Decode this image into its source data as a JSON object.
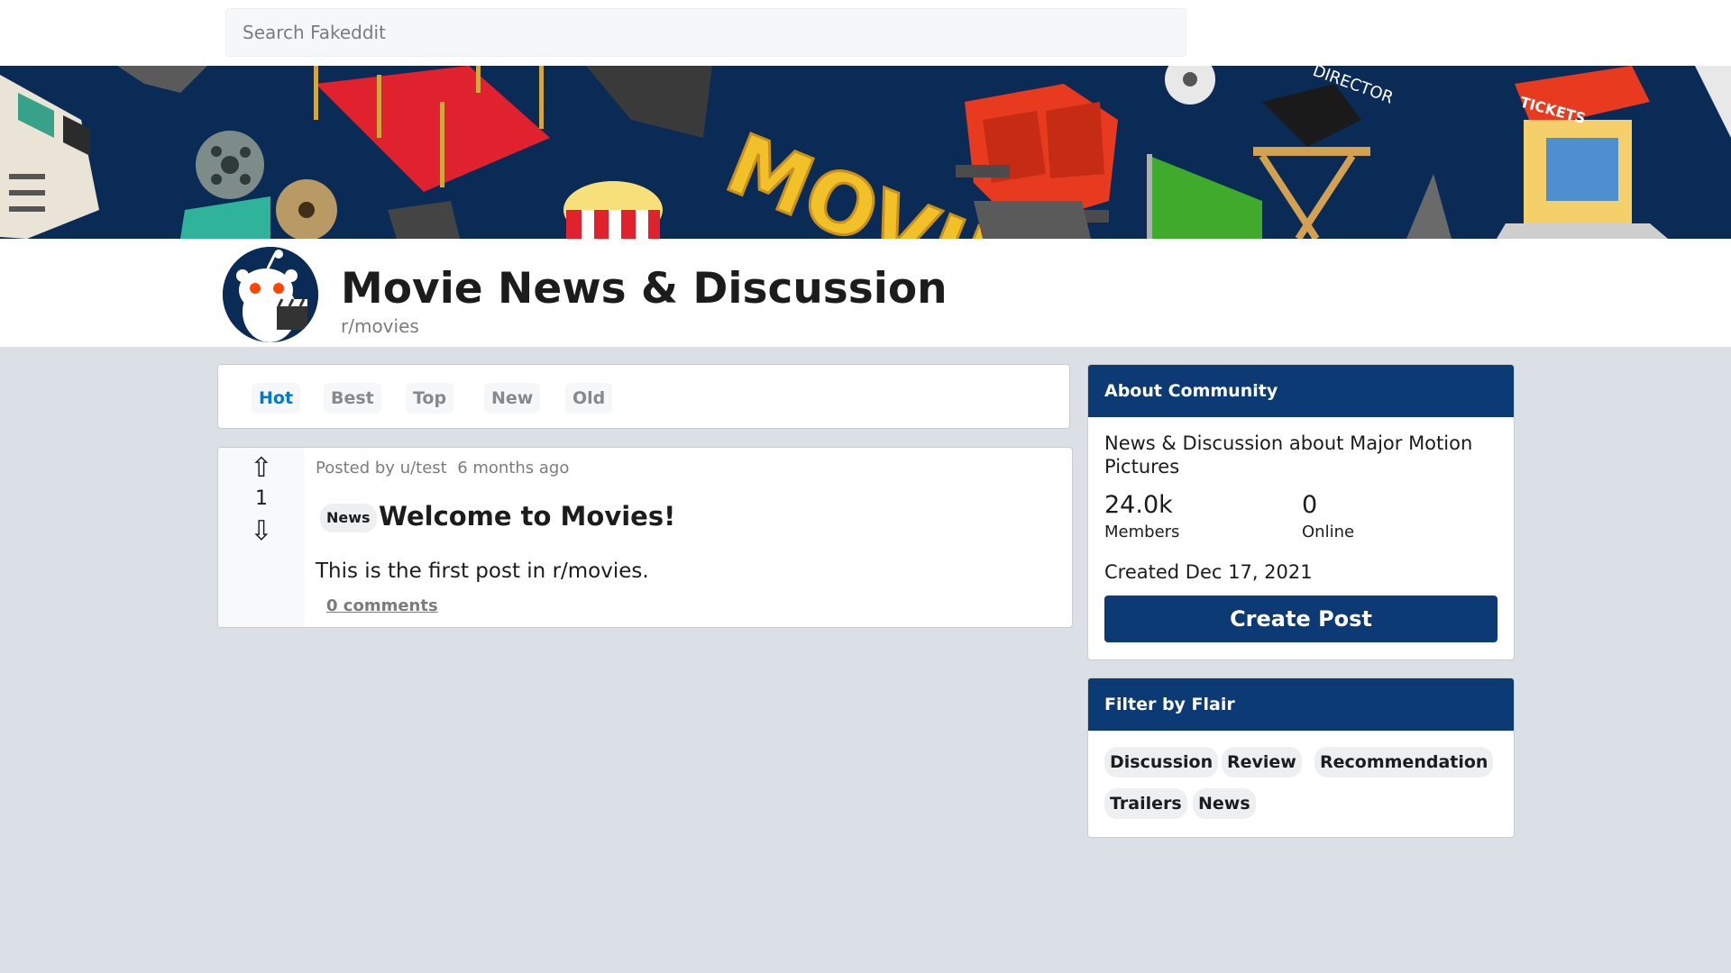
{
  "search": {
    "placeholder": "Search Fakeddit"
  },
  "banner": {
    "sign_text": "MOVIES",
    "tickets_text": "TICKETS",
    "director_text": "DIRECTOR"
  },
  "community": {
    "title": "Movie News & Discussion",
    "name": "r/movies"
  },
  "sort_tabs": [
    {
      "label": "Hot",
      "active": true
    },
    {
      "label": "Best",
      "active": false
    },
    {
      "label": "Top",
      "active": false
    },
    {
      "label": "New",
      "active": false
    },
    {
      "label": "Old",
      "active": false
    }
  ],
  "post": {
    "upvote_icon": "⇧",
    "downvote_icon": "⇩",
    "score": "1",
    "meta_prefix": "Posted by",
    "author": "u/test",
    "time": "6 months ago",
    "flair": "News",
    "title": "Welcome to Movies!",
    "body": "This is the first post in r/movies.",
    "comments": "0 comments"
  },
  "about": {
    "heading": "About Community",
    "description": "News & Discussion about Major Motion Pictures",
    "members_value": "24.0k",
    "members_label": "Members",
    "online_value": "0",
    "online_label": "Online",
    "created": "Created Dec 17, 2021",
    "create_post_label": "Create Post"
  },
  "filter": {
    "heading": "Filter by Flair",
    "flairs": [
      "Discussion",
      "Review",
      "Recommendation",
      "Trailers",
      "News"
    ]
  },
  "colors": {
    "brand_navy": "#0b3a74",
    "active_tab": "#0079d3",
    "page_bg": "#dae0e6"
  }
}
